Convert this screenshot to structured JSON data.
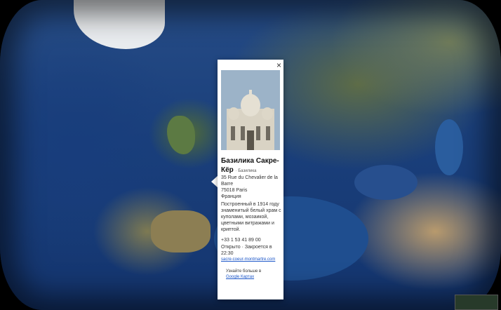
{
  "place": {
    "close_glyph": "×",
    "name": "Базилика Сакре-Кёр",
    "type": "Базилика",
    "address_line1": "35 Rue du Chevalier de la Barre",
    "address_line2": "75018 Paris",
    "country": "Франция",
    "description": "Построенный в 1914 году знаменитый белый храм с куполами, мозаикой, цветными витражами и криптой.",
    "phone": "+33 1 53 41 89 00",
    "hours_status": "Открыто",
    "hours_detail": "Закроется в 22:30",
    "website": "sacre-coeur-montmartre.com",
    "more_prefix": "Узнайте больше в",
    "more_link": "Google Картах"
  },
  "icons": {
    "close": "close-icon",
    "photo": "basilica-photo"
  }
}
